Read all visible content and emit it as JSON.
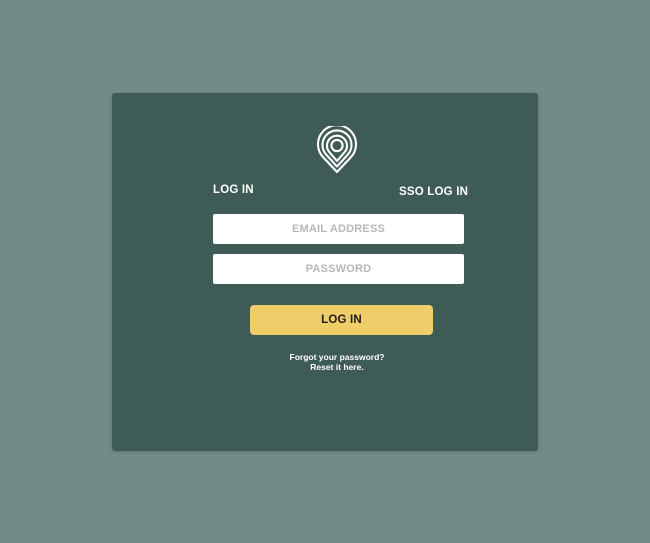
{
  "tabs": {
    "login_label": "LOG IN",
    "sso_label": "SSO LOG IN"
  },
  "form": {
    "email_placeholder": "EMAIL ADDRESS",
    "email_value": "",
    "password_placeholder": "PASSWORD",
    "password_value": "",
    "submit_label": "LOG IN"
  },
  "help": {
    "forgot_text": "Forgot your password?",
    "reset_link": "Reset it here."
  },
  "icons": {
    "logo": "location-pin-icon"
  },
  "colors": {
    "page_background": "#718b86",
    "card_background": "#3f5b55",
    "button_accent": "#efcd69",
    "text_light": "#ffffff"
  }
}
